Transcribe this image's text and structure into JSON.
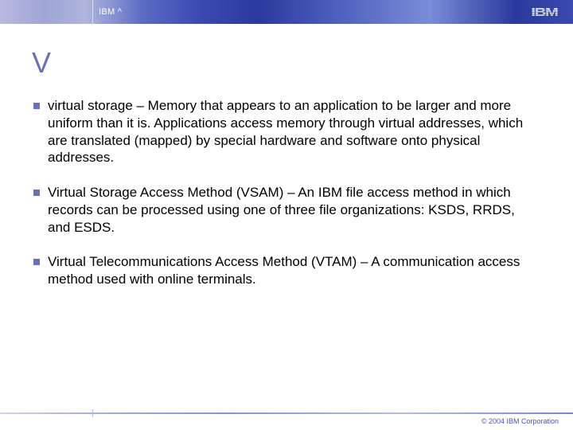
{
  "header": {
    "brand_label": "IBM ^",
    "logo_text": "IBM"
  },
  "title": "V",
  "bullets": [
    "virtual storage – Memory that appears to an application to be larger and more uniform than it is. Applications access memory through virtual addresses, which are translated (mapped) by special hardware and software onto physical addresses.",
    "Virtual Storage Access Method  (VSAM) – An IBM file access method in which records can be processed using one of three file organizations: KSDS, RRDS, and ESDS.",
    "Virtual Telecommunications Access Method (VTAM) – A communication access method used with online terminals."
  ],
  "footer": {
    "copyright": "© 2004 IBM Corporation"
  }
}
